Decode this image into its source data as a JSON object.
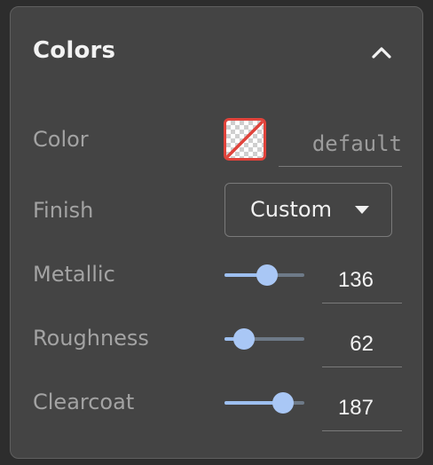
{
  "panel": {
    "title": "Colors",
    "collapse_icon": "chevron-up-icon"
  },
  "color": {
    "label": "Color",
    "swatch_icon": "no-color-swatch-icon",
    "swatch_border_color": "#e0433b",
    "placeholder": "default",
    "value": ""
  },
  "finish": {
    "label": "Finish",
    "selected": "Custom"
  },
  "metallic": {
    "label": "Metallic",
    "value": "136",
    "fraction": 0.53
  },
  "roughness": {
    "label": "Roughness",
    "value": "62",
    "fraction": 0.24
  },
  "clearcoat": {
    "label": "Clearcoat",
    "value": "187",
    "fraction": 0.73
  },
  "colors": {
    "panel_bg": "#444444",
    "accent": "#a9c7f5",
    "label": "#a3a3a3"
  }
}
